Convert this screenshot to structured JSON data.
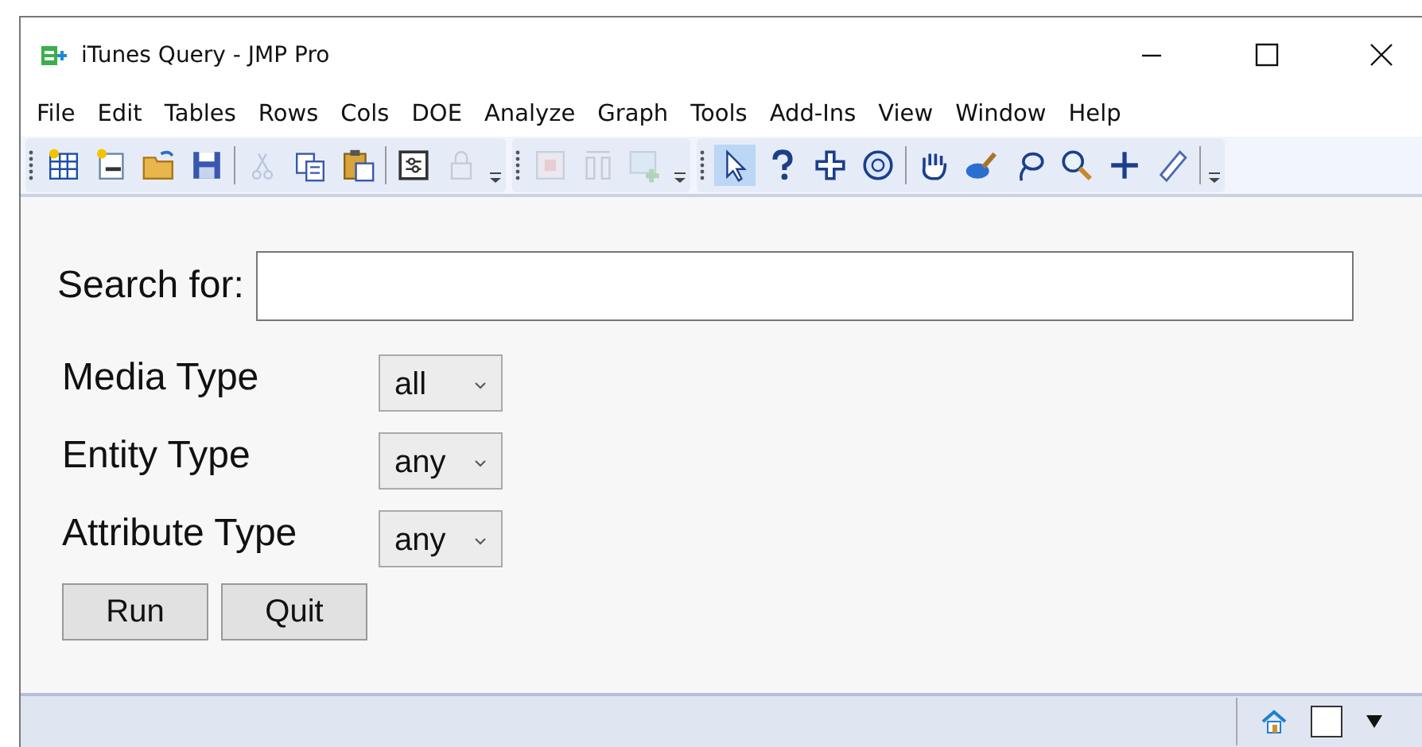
{
  "window": {
    "title": "iTunes Query - JMP Pro"
  },
  "menu": [
    "File",
    "Edit",
    "Tables",
    "Rows",
    "Cols",
    "DOE",
    "Analyze",
    "Graph",
    "Tools",
    "Add-Ins",
    "View",
    "Window",
    "Help"
  ],
  "toolbar": [
    {
      "items": [
        {
          "kind": "new-table",
          "disabled": false,
          "selected": false
        },
        {
          "kind": "new-script",
          "disabled": false,
          "selected": false
        },
        {
          "kind": "open",
          "disabled": false,
          "selected": false
        },
        {
          "kind": "save",
          "disabled": false,
          "selected": false
        },
        {
          "kind": "separator"
        },
        {
          "kind": "cut",
          "disabled": true,
          "selected": false
        },
        {
          "kind": "copy",
          "disabled": false,
          "selected": false
        },
        {
          "kind": "paste",
          "disabled": false,
          "selected": false
        },
        {
          "kind": "separator"
        },
        {
          "kind": "dialog",
          "disabled": false,
          "selected": false
        },
        {
          "kind": "lock",
          "disabled": true,
          "selected": false
        }
      ]
    },
    {
      "items": [
        {
          "kind": "grid",
          "disabled": true,
          "selected": false
        },
        {
          "kind": "columns",
          "disabled": true,
          "selected": false
        },
        {
          "kind": "map",
          "disabled": true,
          "selected": false
        }
      ]
    },
    {
      "items": [
        {
          "kind": "arrow",
          "disabled": false,
          "selected": true
        },
        {
          "kind": "help",
          "disabled": false,
          "selected": false
        },
        {
          "kind": "cross",
          "disabled": false,
          "selected": false
        },
        {
          "kind": "target",
          "disabled": false,
          "selected": false
        },
        {
          "kind": "separator"
        },
        {
          "kind": "hand",
          "disabled": false,
          "selected": false
        },
        {
          "kind": "brush",
          "disabled": false,
          "selected": false
        },
        {
          "kind": "lasso",
          "disabled": false,
          "selected": false
        },
        {
          "kind": "zoom",
          "disabled": false,
          "selected": false
        },
        {
          "kind": "plus",
          "disabled": false,
          "selected": false
        },
        {
          "kind": "ruler",
          "disabled": false,
          "selected": false
        },
        {
          "kind": "separator"
        }
      ]
    }
  ],
  "form": {
    "search_label": "Search for:",
    "options": [
      {
        "label": "Media Type",
        "value": "all"
      },
      {
        "label": "Entity Type",
        "value": "any"
      },
      {
        "label": "Attribute Type",
        "value": "any"
      }
    ],
    "buttons": [
      "Run",
      "Quit"
    ]
  },
  "status_bar": {
    "checked": false
  }
}
